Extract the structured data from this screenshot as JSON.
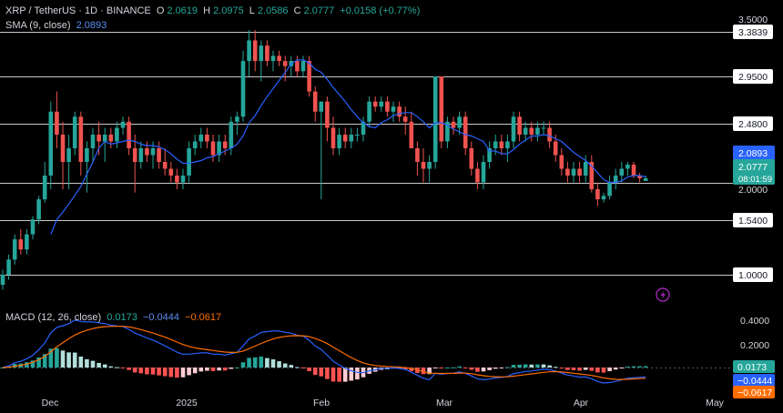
{
  "header": {
    "symbol": "XRP / TetherUS · 1D · BINANCE",
    "o_label": "O",
    "o_value": "2.0619",
    "h_label": "H",
    "h_value": "2.0975",
    "l_label": "L",
    "l_value": "2.0586",
    "c_label": "C",
    "c_value": "2.0777",
    "change": "+0.0158 (+0.77%)",
    "sma_label": "SMA (9, close)",
    "sma_value": "2.0893"
  },
  "macd_legend": {
    "label": "MACD (12, 26, close)",
    "value1": "0.0173",
    "value2": "−0.0444",
    "value3": "−0.0617"
  },
  "colors": {
    "background": "#000000",
    "up": "#26a69a",
    "down": "#ef5350",
    "sma": "#2962ff",
    "macd_line": "#2962ff",
    "signal_line": "#ff6d00",
    "level_line": "#c8c8c8"
  },
  "icon": "lightning-bolt-icon",
  "chart_data": [
    {
      "type": "candlestick",
      "symbol": "XRP / TetherUS",
      "y_ticks": [
        "3.5000",
        "3.3839",
        "2.9500",
        "2.4800",
        "2.0000",
        "1.5400",
        "1.0000"
      ],
      "horizontal_levels": [
        3.3839,
        2.95,
        2.48,
        2.05,
        1.54,
        1.0
      ],
      "price_labels": {
        "sma": "2.0893",
        "last": "2.0777",
        "countdown": "08:01:59"
      },
      "x_ticks": [
        "Dec",
        "2025",
        "Feb",
        "Mar",
        "Apr",
        "May"
      ],
      "ohlc": [
        [
          0.9,
          1.05,
          0.85,
          1.0
        ],
        [
          1.0,
          1.2,
          0.95,
          1.15
        ],
        [
          1.15,
          1.4,
          1.1,
          1.35
        ],
        [
          1.35,
          1.45,
          1.2,
          1.25
        ],
        [
          1.25,
          1.45,
          1.2,
          1.4
        ],
        [
          1.4,
          1.6,
          1.35,
          1.55
        ],
        [
          1.55,
          1.9,
          1.5,
          1.85
        ],
        [
          1.85,
          2.2,
          1.8,
          2.1
        ],
        [
          2.1,
          2.7,
          2.0,
          2.6
        ],
        [
          2.6,
          2.8,
          2.3,
          2.4
        ],
        [
          2.4,
          2.5,
          2.0,
          2.2
        ],
        [
          2.2,
          2.4,
          2.0,
          2.3
        ],
        [
          2.3,
          2.6,
          2.25,
          2.55
        ],
        [
          2.55,
          2.6,
          2.1,
          2.2
        ],
        [
          2.2,
          2.35,
          1.95,
          2.3
        ],
        [
          2.3,
          2.45,
          2.2,
          2.4
        ],
        [
          2.4,
          2.5,
          2.25,
          2.35
        ],
        [
          2.35,
          2.45,
          2.2,
          2.4
        ],
        [
          2.4,
          2.45,
          2.3,
          2.35
        ],
        [
          2.35,
          2.5,
          2.3,
          2.45
        ],
        [
          2.45,
          2.55,
          2.4,
          2.5
        ],
        [
          2.5,
          2.55,
          2.25,
          2.3
        ],
        [
          2.3,
          2.4,
          1.95,
          2.2
        ],
        [
          2.2,
          2.35,
          2.15,
          2.3
        ],
        [
          2.3,
          2.35,
          2.2,
          2.25
        ],
        [
          2.25,
          2.35,
          2.15,
          2.3
        ],
        [
          2.3,
          2.35,
          2.15,
          2.2
        ],
        [
          2.2,
          2.3,
          2.1,
          2.15
        ],
        [
          2.15,
          2.2,
          2.05,
          2.1
        ],
        [
          2.1,
          2.15,
          2.0,
          2.05
        ],
        [
          2.05,
          2.15,
          2.0,
          2.1
        ],
        [
          2.1,
          2.35,
          2.05,
          2.3
        ],
        [
          2.3,
          2.4,
          2.25,
          2.35
        ],
        [
          2.35,
          2.45,
          2.3,
          2.4
        ],
        [
          2.4,
          2.45,
          2.3,
          2.35
        ],
        [
          2.35,
          2.4,
          2.2,
          2.25
        ],
        [
          2.25,
          2.4,
          2.2,
          2.35
        ],
        [
          2.35,
          2.4,
          2.25,
          2.3
        ],
        [
          2.3,
          2.55,
          2.25,
          2.5
        ],
        [
          2.5,
          2.6,
          2.4,
          2.55
        ],
        [
          2.55,
          3.2,
          2.5,
          3.1
        ],
        [
          3.1,
          3.4,
          2.95,
          3.3
        ],
        [
          3.3,
          3.4,
          3.0,
          3.1
        ],
        [
          3.1,
          3.3,
          2.9,
          3.25
        ],
        [
          3.25,
          3.3,
          3.05,
          3.1
        ],
        [
          3.1,
          3.2,
          3.0,
          3.15
        ],
        [
          3.15,
          3.2,
          3.05,
          3.1
        ],
        [
          3.1,
          3.15,
          2.9,
          3.05
        ],
        [
          3.05,
          3.15,
          2.95,
          3.1
        ],
        [
          3.1,
          3.15,
          2.95,
          3.0
        ],
        [
          3.0,
          3.15,
          2.95,
          3.1
        ],
        [
          3.1,
          3.15,
          2.75,
          2.8
        ],
        [
          2.8,
          2.85,
          2.5,
          2.6
        ],
        [
          2.6,
          2.7,
          1.85,
          2.7
        ],
        [
          2.7,
          2.75,
          2.35,
          2.45
        ],
        [
          2.45,
          2.55,
          2.25,
          2.3
        ],
        [
          2.3,
          2.45,
          2.25,
          2.4
        ],
        [
          2.4,
          2.45,
          2.3,
          2.35
        ],
        [
          2.35,
          2.45,
          2.3,
          2.4
        ],
        [
          2.4,
          2.45,
          2.35,
          2.4
        ],
        [
          2.4,
          2.55,
          2.35,
          2.5
        ],
        [
          2.5,
          2.75,
          2.45,
          2.7
        ],
        [
          2.7,
          2.75,
          2.6,
          2.65
        ],
        [
          2.65,
          2.75,
          2.6,
          2.7
        ],
        [
          2.7,
          2.75,
          2.55,
          2.6
        ],
        [
          2.6,
          2.7,
          2.5,
          2.65
        ],
        [
          2.65,
          2.7,
          2.5,
          2.55
        ],
        [
          2.55,
          2.65,
          2.4,
          2.5
        ],
        [
          2.5,
          2.6,
          2.3,
          2.3
        ],
        [
          2.3,
          2.35,
          2.1,
          2.2
        ],
        [
          2.2,
          2.3,
          2.05,
          2.15
        ],
        [
          2.15,
          2.25,
          2.05,
          2.2
        ],
        [
          2.2,
          2.95,
          2.15,
          2.95
        ],
        [
          2.95,
          2.95,
          2.3,
          2.35
        ],
        [
          2.35,
          2.55,
          2.3,
          2.5
        ],
        [
          2.5,
          2.55,
          2.4,
          2.45
        ],
        [
          2.45,
          2.6,
          2.4,
          2.55
        ],
        [
          2.55,
          2.6,
          2.25,
          2.3
        ],
        [
          2.3,
          2.35,
          2.1,
          2.15
        ],
        [
          2.15,
          2.2,
          2.0,
          2.05
        ],
        [
          2.05,
          2.25,
          2.0,
          2.2
        ],
        [
          2.2,
          2.35,
          2.15,
          2.3
        ],
        [
          2.3,
          2.4,
          2.25,
          2.35
        ],
        [
          2.35,
          2.4,
          2.25,
          2.3
        ],
        [
          2.3,
          2.4,
          2.2,
          2.35
        ],
        [
          2.35,
          2.6,
          2.3,
          2.55
        ],
        [
          2.55,
          2.6,
          2.35,
          2.4
        ],
        [
          2.4,
          2.5,
          2.35,
          2.45
        ],
        [
          2.45,
          2.5,
          2.35,
          2.4
        ],
        [
          2.4,
          2.5,
          2.35,
          2.45
        ],
        [
          2.45,
          2.5,
          2.4,
          2.45
        ],
        [
          2.45,
          2.5,
          2.3,
          2.35
        ],
        [
          2.35,
          2.4,
          2.2,
          2.25
        ],
        [
          2.25,
          2.3,
          2.1,
          2.15
        ],
        [
          2.15,
          2.2,
          2.05,
          2.1
        ],
        [
          2.1,
          2.2,
          2.05,
          2.15
        ],
        [
          2.15,
          2.2,
          2.05,
          2.1
        ],
        [
          2.1,
          2.25,
          2.05,
          2.2
        ],
        [
          2.2,
          2.25,
          1.95,
          2.0
        ],
        [
          2.0,
          2.05,
          1.75,
          1.85
        ],
        [
          1.85,
          1.95,
          1.8,
          1.9
        ],
        [
          1.9,
          2.1,
          1.85,
          2.05
        ],
        [
          2.05,
          2.15,
          2.0,
          2.1
        ],
        [
          2.1,
          2.2,
          2.05,
          2.15
        ],
        [
          2.15,
          2.2,
          2.1,
          2.18
        ],
        [
          2.18,
          2.2,
          2.08,
          2.1
        ],
        [
          2.1,
          2.12,
          2.05,
          2.08
        ],
        [
          2.06,
          2.1,
          2.06,
          2.08
        ]
      ],
      "sma": [
        null,
        null,
        null,
        null,
        null,
        null,
        null,
        null,
        1.4,
        1.55,
        1.66,
        1.78,
        1.91,
        2.02,
        2.11,
        2.2,
        2.3,
        2.35,
        2.33,
        2.34,
        2.35,
        2.36,
        2.35,
        2.33,
        2.32,
        2.32,
        2.31,
        2.29,
        2.26,
        2.22,
        2.19,
        2.19,
        2.2,
        2.21,
        2.23,
        2.24,
        2.26,
        2.28,
        2.3,
        2.33,
        2.39,
        2.49,
        2.56,
        2.66,
        2.75,
        2.83,
        2.91,
        2.99,
        3.07,
        3.11,
        3.11,
        3.08,
        3.02,
        2.99,
        2.92,
        2.84,
        2.77,
        2.7,
        2.62,
        2.55,
        2.49,
        2.46,
        2.45,
        2.49,
        2.52,
        2.56,
        2.58,
        2.59,
        2.59,
        2.55,
        2.5,
        2.45,
        2.49,
        2.49,
        2.47,
        2.44,
        2.42,
        2.4,
        2.39,
        2.37,
        2.35,
        2.28,
        2.28,
        2.26,
        2.26,
        2.29,
        2.33,
        2.36,
        2.39,
        2.39,
        2.4,
        2.39,
        2.37,
        2.35,
        2.31,
        2.27,
        2.24,
        2.21,
        2.17,
        2.12,
        2.07,
        2.05,
        2.05,
        2.06,
        2.09,
        2.1,
        2.1,
        2.09
      ]
    },
    {
      "type": "histogram+line",
      "indicator": "MACD (12, 26, close)",
      "y_ticks": [
        "0.4000",
        "0.2000"
      ],
      "price_labels": [
        "0.0173",
        "−0.0444",
        "−0.0617"
      ],
      "x_ticks": [
        "Dec",
        "2025",
        "Feb",
        "Mar",
        "Apr",
        "May"
      ]
    }
  ]
}
